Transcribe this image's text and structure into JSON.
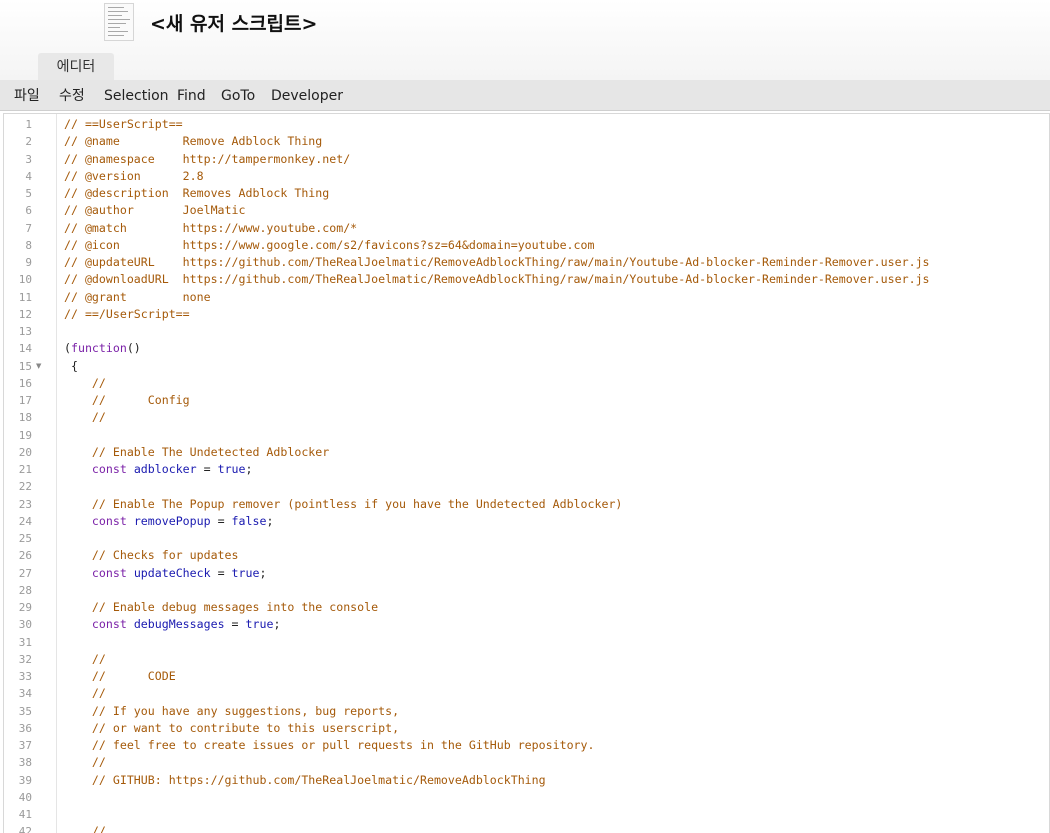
{
  "window": {
    "title": "<새 유저 스크립트>",
    "tab": "에디터"
  },
  "menu": [
    "파일",
    "수정",
    "Selection",
    "Find",
    "GoTo",
    "Developer"
  ],
  "editor": {
    "folded_line": 15,
    "lines": [
      {
        "n": "1",
        "code": "// ==UserScript=="
      },
      {
        "n": "2",
        "code": "// @name         Remove Adblock Thing"
      },
      {
        "n": "3",
        "code": "// @namespace    http://tampermonkey.net/"
      },
      {
        "n": "4",
        "code": "// @version      2.8"
      },
      {
        "n": "5",
        "code": "// @description  Removes Adblock Thing"
      },
      {
        "n": "6",
        "code": "// @author       JoelMatic"
      },
      {
        "n": "7",
        "code": "// @match        https://www.youtube.com/*"
      },
      {
        "n": "8",
        "code": "// @icon         https://www.google.com/s2/favicons?sz=64&domain=youtube.com"
      },
      {
        "n": "9",
        "code": "// @updateURL    https://github.com/TheRealJoelmatic/RemoveAdblockThing/raw/main/Youtube-Ad-blocker-Reminder-Remover.user.js"
      },
      {
        "n": "10",
        "code": "// @downloadURL  https://github.com/TheRealJoelmatic/RemoveAdblockThing/raw/main/Youtube-Ad-blocker-Reminder-Remover.user.js"
      },
      {
        "n": "11",
        "code": "// @grant        none"
      },
      {
        "n": "12",
        "code": "// ==/UserScript=="
      },
      {
        "n": "13",
        "code": ""
      },
      {
        "n": "14",
        "code": "(function()"
      },
      {
        "n": "15",
        "code": " {"
      },
      {
        "n": "16",
        "code": "    //"
      },
      {
        "n": "17",
        "code": "    //      Config"
      },
      {
        "n": "18",
        "code": "    //"
      },
      {
        "n": "19",
        "code": ""
      },
      {
        "n": "20",
        "code": "    // Enable The Undetected Adblocker"
      },
      {
        "n": "21",
        "code": "    const adblocker = true;"
      },
      {
        "n": "22",
        "code": ""
      },
      {
        "n": "23",
        "code": "    // Enable The Popup remover (pointless if you have the Undetected Adblocker)"
      },
      {
        "n": "24",
        "code": "    const removePopup = false;"
      },
      {
        "n": "25",
        "code": ""
      },
      {
        "n": "26",
        "code": "    // Checks for updates"
      },
      {
        "n": "27",
        "code": "    const updateCheck = true;"
      },
      {
        "n": "28",
        "code": ""
      },
      {
        "n": "29",
        "code": "    // Enable debug messages into the console"
      },
      {
        "n": "30",
        "code": "    const debugMessages = true;"
      },
      {
        "n": "31",
        "code": ""
      },
      {
        "n": "32",
        "code": "    //"
      },
      {
        "n": "33",
        "code": "    //      CODE"
      },
      {
        "n": "34",
        "code": "    //"
      },
      {
        "n": "35",
        "code": "    // If you have any suggestions, bug reports,"
      },
      {
        "n": "36",
        "code": "    // or want to contribute to this userscript,"
      },
      {
        "n": "37",
        "code": "    // feel free to create issues or pull requests in the GitHub repository."
      },
      {
        "n": "38",
        "code": "    //"
      },
      {
        "n": "39",
        "code": "    // GITHUB: https://github.com/TheRealJoelmatic/RemoveAdblockThing"
      },
      {
        "n": "40",
        "code": ""
      },
      {
        "n": "41",
        "code": ""
      },
      {
        "n": "42",
        "code": "    //"
      }
    ]
  },
  "colors": {
    "comment": "#a55a0a",
    "keyword": "#7b22a8",
    "variable": "#1a1ab0",
    "menubar": "#e6e6e6"
  }
}
